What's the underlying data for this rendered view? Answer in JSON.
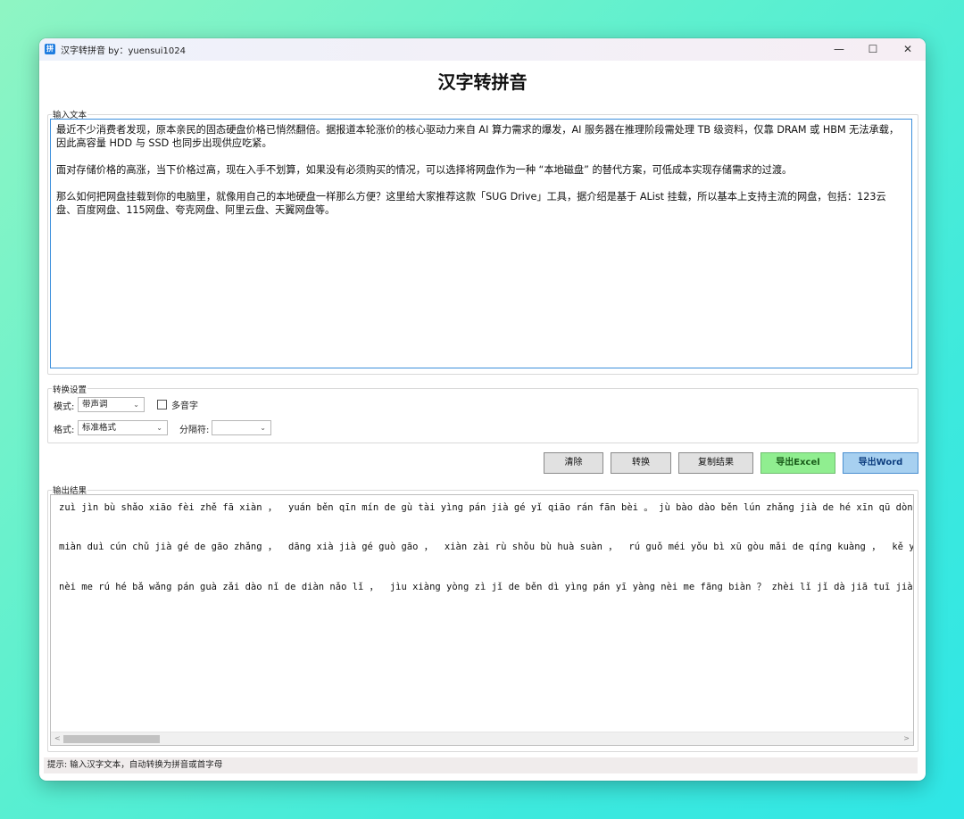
{
  "window": {
    "title": "汉字转拼音 by：yuensui1024",
    "icon_glyph": "拼",
    "minimize": "—",
    "maximize": "☐",
    "close": "✕"
  },
  "app": {
    "heading": "汉字转拼音"
  },
  "input": {
    "group_label": "输入文本",
    "paragraphs": [
      "最近不少消费者发现，原本亲民的固态硬盘价格已悄然翻倍。据报道本轮涨价的核心驱动力来自 AI 算力需求的爆发，AI 服务器在推理阶段需处理 TB 级资料，仅靠 DRAM 或 HBM 无法承载，因此高容量 HDD 与 SSD 也同步出现供应吃紧。",
      "面对存储价格的高涨，当下价格过高，现在入手不划算，如果没有必须购买的情况，可以选择将网盘作为一种 “本地磁盘” 的替代方案，可低成本实现存储需求的过渡。",
      "那么如何把网盘挂载到你的电脑里，就像用自己的本地硬盘一样那么方便？这里给大家推荐这款「SUG Drive」工具，据介绍是基于 AList 挂载，所以基本上支持主流的网盘，包括：123云盘、百度网盘、115网盘、夸克网盘、阿里云盘、天翼网盘等。"
    ]
  },
  "settings": {
    "group_label": "转换设置",
    "mode_label": "模式:",
    "mode_value": "带声调",
    "polyphone_label": "多音字",
    "polyphone_checked": false,
    "format_label": "格式:",
    "format_value": "标准格式",
    "separator_label": "分隔符:",
    "separator_value": ""
  },
  "buttons": {
    "clear": "清除",
    "convert": "转换",
    "copy": "复制结果",
    "export_excel": "导出Excel",
    "export_word": "导出Word"
  },
  "output": {
    "group_label": "输出结果",
    "lines": [
      "zuì jìn bù shǎo xiāo fèi zhě fā xiàn ，  yuán běn qīn mín de gù tài yìng pán jià gé yǐ qiāo rán fān bèi 。 jù bào dào běn lún zhǎng jià de hé xīn qū dòng",
      "miàn duì cún chǔ jià gé de gāo zhǎng ，  dāng xià jià gé guò gāo ，  xiàn zài rù shǒu bù huà suàn ，  rú guǒ méi yǒu bì xū gòu mǎi de qíng kuàng ，  kě yǐ",
      "nèi me rú hé bǎ wǎng pán guà zǎi dào nǐ de diàn nǎo lǐ ，  jìu xiàng yòng zì jǐ de běn dì yìng pán yī yàng nèi me fāng biàn ？ zhèi lǐ jǐ dà jiā tuī jiàn"
    ]
  },
  "status": {
    "text": "提示: 输入汉字文本，自动转换为拼音或首字母"
  },
  "colors": {
    "excel_button": "#90ee90",
    "word_button": "#a7d0f0",
    "input_border": "#3c8fdc"
  }
}
